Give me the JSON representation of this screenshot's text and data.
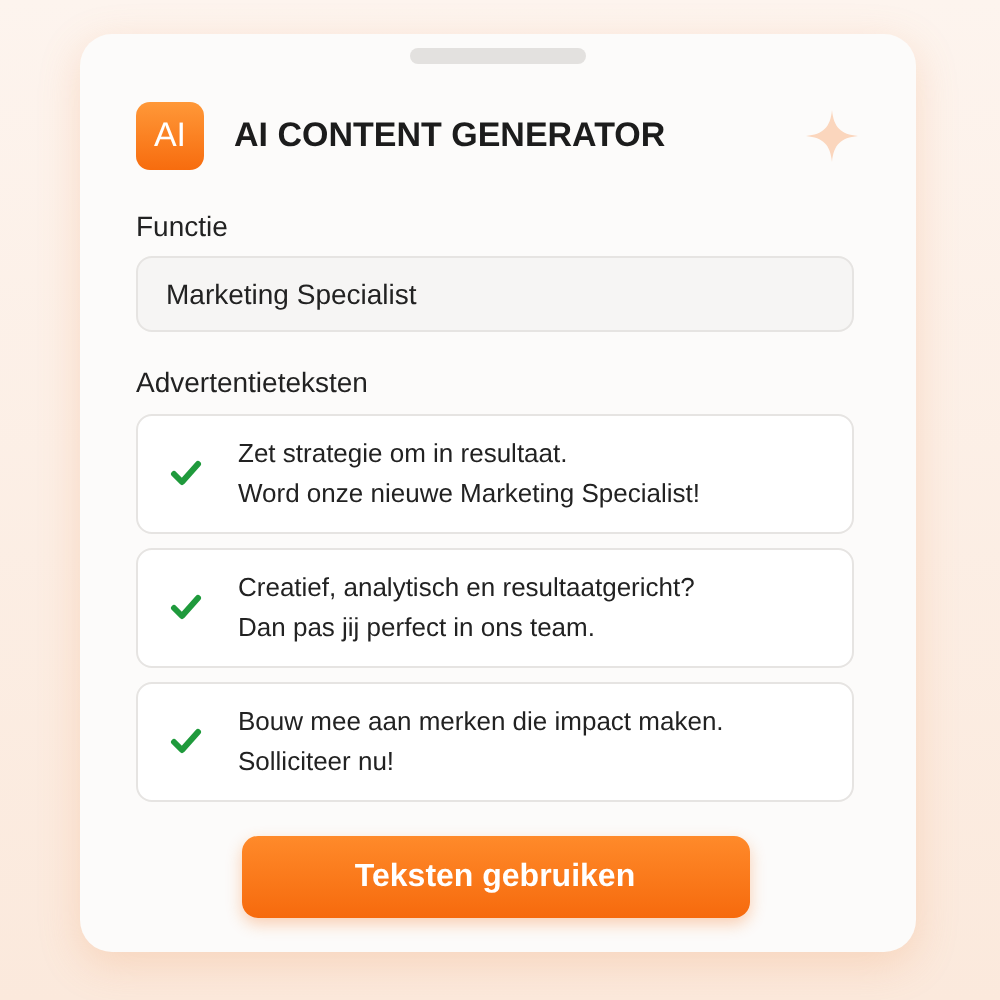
{
  "header": {
    "logo": "AI",
    "title": "AI CONTENT GENERATOR"
  },
  "function_field": {
    "label": "Functie",
    "value": "Marketing Specialist"
  },
  "ads": {
    "label": "Advertentieteksten",
    "items": [
      {
        "lines": [
          "Zet strategie om in resultaat.",
          "Word onze nieuwe Marketing Specialist!"
        ],
        "checked": true
      },
      {
        "lines": [
          "Creatief, analytisch en resultaatgericht?",
          "Dan pas jij perfect in ons team."
        ],
        "checked": true
      },
      {
        "lines": [
          "Bouw mee aan merken die impact maken.",
          "Solliciteer nu!"
        ],
        "checked": true
      }
    ]
  },
  "button": "Teksten gebruiken"
}
